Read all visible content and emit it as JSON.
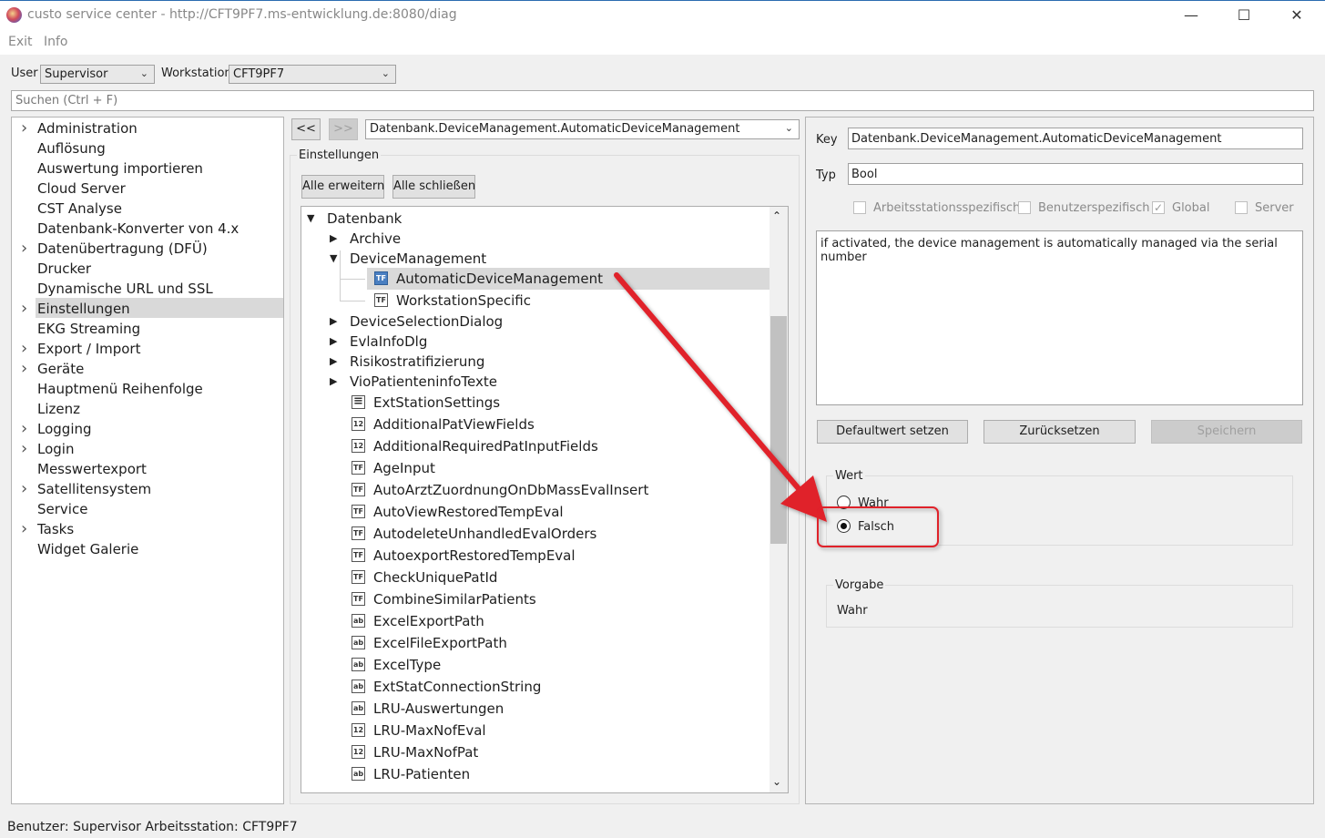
{
  "window": {
    "title": "custo service center - http://CFT9PF7.ms-entwicklung.de:8080/diag",
    "minimize": "—",
    "maximize": "☐",
    "close": "✕"
  },
  "menu": {
    "exit": "Exit",
    "info": "Info"
  },
  "toolbar": {
    "user_label": "User",
    "user_value": "Supervisor",
    "workstation_label": "Workstation",
    "workstation_value": "CFT9PF7"
  },
  "search": {
    "placeholder": "Suchen (Ctrl + F)"
  },
  "nav": {
    "items": [
      {
        "label": "Administration",
        "expandable": true
      },
      {
        "label": "Auflösung",
        "expandable": false
      },
      {
        "label": "Auswertung importieren",
        "expandable": false
      },
      {
        "label": "Cloud Server",
        "expandable": false
      },
      {
        "label": "CST Analyse",
        "expandable": false
      },
      {
        "label": "Datenbank-Konverter von 4.x",
        "expandable": false
      },
      {
        "label": "Datenübertragung (DFÜ)",
        "expandable": true
      },
      {
        "label": "Drucker",
        "expandable": false
      },
      {
        "label": "Dynamische URL und SSL",
        "expandable": false
      },
      {
        "label": "Einstellungen",
        "expandable": true,
        "selected": true
      },
      {
        "label": "EKG Streaming",
        "expandable": false
      },
      {
        "label": "Export / Import",
        "expandable": true
      },
      {
        "label": "Geräte",
        "expandable": true
      },
      {
        "label": "Hauptmenü Reihenfolge",
        "expandable": false
      },
      {
        "label": "Lizenz",
        "expandable": false
      },
      {
        "label": "Logging",
        "expandable": true
      },
      {
        "label": "Login",
        "expandable": true
      },
      {
        "label": "Messwertexport",
        "expandable": false
      },
      {
        "label": "Satellitensystem",
        "expandable": true
      },
      {
        "label": "Service",
        "expandable": false
      },
      {
        "label": "Tasks",
        "expandable": true
      },
      {
        "label": "Widget Galerie",
        "expandable": false
      }
    ]
  },
  "middle": {
    "back": "<<",
    "forward": ">>",
    "path": "Datenbank.DeviceManagement.AutomaticDeviceManagement",
    "group_title": "Einstellungen",
    "expand_all": "Alle erweitern",
    "collapse_all": "Alle schließen",
    "tree": [
      {
        "label": "Datenbank",
        "indent": 0,
        "toggle": "open",
        "icon": ""
      },
      {
        "label": "Archive",
        "indent": 1,
        "toggle": "closed",
        "icon": ""
      },
      {
        "label": "DeviceManagement",
        "indent": 1,
        "toggle": "open",
        "icon": ""
      },
      {
        "label": "AutomaticDeviceManagement",
        "indent": 2,
        "toggle": "",
        "icon": "TF",
        "selected": true
      },
      {
        "label": "WorkstationSpecific",
        "indent": 2,
        "toggle": "",
        "icon": "TF"
      },
      {
        "label": "DeviceSelectionDialog",
        "indent": 1,
        "toggle": "closed",
        "icon": ""
      },
      {
        "label": "EvlaInfoDlg",
        "indent": 1,
        "toggle": "closed",
        "icon": ""
      },
      {
        "label": "Risikostratifizierung",
        "indent": 1,
        "toggle": "closed",
        "icon": ""
      },
      {
        "label": "VioPatienteninfoTexte",
        "indent": 1,
        "toggle": "closed",
        "icon": ""
      },
      {
        "label": "ExtStationSettings",
        "indent": 1,
        "toggle": "",
        "icon": "doc"
      },
      {
        "label": "AdditionalPatViewFields",
        "indent": 1,
        "toggle": "",
        "icon": "12"
      },
      {
        "label": "AdditionalRequiredPatInputFields",
        "indent": 1,
        "toggle": "",
        "icon": "12"
      },
      {
        "label": "AgeInput",
        "indent": 1,
        "toggle": "",
        "icon": "TF"
      },
      {
        "label": "AutoArztZuordnungOnDbMassEvalInsert",
        "indent": 1,
        "toggle": "",
        "icon": "TF"
      },
      {
        "label": "AutoViewRestoredTempEval",
        "indent": 1,
        "toggle": "",
        "icon": "TF"
      },
      {
        "label": "AutodeleteUnhandledEvalOrders",
        "indent": 1,
        "toggle": "",
        "icon": "TF"
      },
      {
        "label": "AutoexportRestoredTempEval",
        "indent": 1,
        "toggle": "",
        "icon": "TF"
      },
      {
        "label": "CheckUniquePatId",
        "indent": 1,
        "toggle": "",
        "icon": "TF"
      },
      {
        "label": "CombineSimilarPatients",
        "indent": 1,
        "toggle": "",
        "icon": "TF"
      },
      {
        "label": "ExcelExportPath",
        "indent": 1,
        "toggle": "",
        "icon": "ab"
      },
      {
        "label": "ExcelFileExportPath",
        "indent": 1,
        "toggle": "",
        "icon": "ab"
      },
      {
        "label": "ExcelType",
        "indent": 1,
        "toggle": "",
        "icon": "ab"
      },
      {
        "label": "ExtStatConnectionString",
        "indent": 1,
        "toggle": "",
        "icon": "ab"
      },
      {
        "label": "LRU-Auswertungen",
        "indent": 1,
        "toggle": "",
        "icon": "ab"
      },
      {
        "label": "LRU-MaxNofEval",
        "indent": 1,
        "toggle": "",
        "icon": "12"
      },
      {
        "label": "LRU-MaxNofPat",
        "indent": 1,
        "toggle": "",
        "icon": "12"
      },
      {
        "label": "LRU-Patienten",
        "indent": 1,
        "toggle": "",
        "icon": "ab"
      }
    ]
  },
  "detail": {
    "key_label": "Key",
    "key_value": "Datenbank.DeviceManagement.AutomaticDeviceManagement",
    "type_label": "Typ",
    "type_value": "Bool",
    "checkboxes": [
      {
        "label": "Arbeitsstationsspezifisch",
        "checked": false
      },
      {
        "label": "Benutzerspezifisch",
        "checked": false
      },
      {
        "label": "Global",
        "checked": true
      },
      {
        "label": "Server",
        "checked": false
      }
    ],
    "description": "if activated, the device management is automatically managed via the serial number",
    "btn_default": "Defaultwert setzen",
    "btn_reset": "Zurücksetzen",
    "btn_save": "Speichern",
    "value_group": "Wert",
    "radio_true": "Wahr",
    "radio_false": "Falsch",
    "selected_value": "Falsch",
    "default_group": "Vorgabe",
    "default_value": "Wahr",
    "highlight_color": "#e0202a"
  },
  "status": {
    "text": "Benutzer: Supervisor Arbeitsstation: CFT9PF7"
  }
}
